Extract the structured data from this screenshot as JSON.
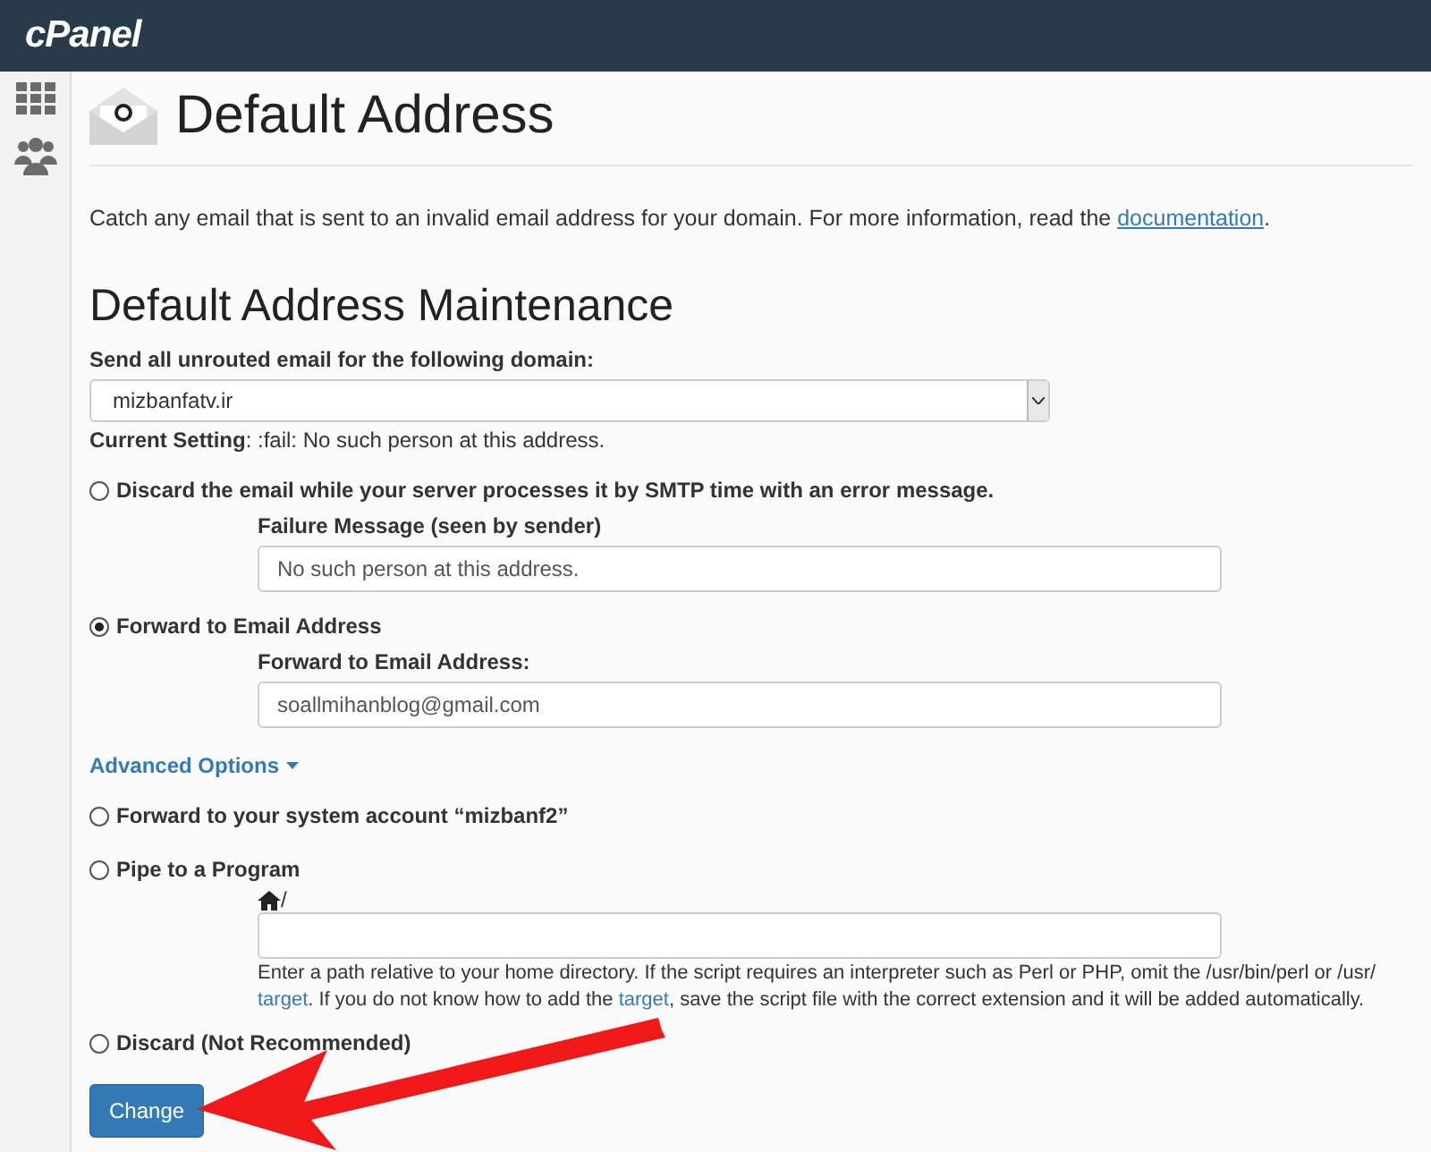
{
  "header": {
    "logo": "cPanel"
  },
  "sidebar": {
    "items": [
      {
        "kind": "grid"
      },
      {
        "kind": "users"
      }
    ]
  },
  "page": {
    "title": "Default Address",
    "intro": "Catch any email that is sent to an invalid email address for your domain. For more information, read the ",
    "intro_link": "documentation",
    "intro_end": "."
  },
  "section": {
    "heading": "Default Address Maintenance",
    "domain_label": "Send all unrouted email for the following domain:",
    "domain_value": "mizbanfatv.ir",
    "current_setting": "**Current Setting**: :fail: No such person at this address."
  },
  "options": [
    {
      "kind": "field",
      "label": "Discard the email while your server processes it by SMTP time with an error message.",
      "selected": false,
      "field": {
        "label": "Failure Message (seen by sender)",
        "value": "No such person at this address."
      }
    },
    {
      "kind": "field",
      "label": "Forward to Email Address",
      "selected": true,
      "field": {
        "label": "Forward to Email Address:",
        "value": "soallmihanblog@gmail.com"
      }
    },
    {
      "kind": "toggle",
      "label": "Advanced Options"
    },
    {
      "kind": "plain",
      "label": "Forward to your system account “mizbanf2”",
      "selected": false
    },
    {
      "kind": "pipe",
      "label": "Pipe to a Program",
      "selected": false,
      "path_prefix": "/",
      "help": [
        [
          {
            "text": "Enter a path relative to your home directory. If the script requires an interpreter such as Perl or PHP, omit the /usr/bin/perl or /usr/",
            "link": false
          }
        ],
        [
          {
            "text": "target",
            "link": true
          },
          {
            "text": ". If you do not know how to add the ",
            "link": false
          },
          {
            "text": "target",
            "link": true
          },
          {
            "text": ", save the script file with the correct extension and it will be added automatically.",
            "link": false
          }
        ]
      ]
    },
    {
      "kind": "plain",
      "label": "Discard (Not Recommended)",
      "selected": false
    }
  ],
  "submit": "Change",
  "annotation": {
    "kind": "arrow"
  }
}
